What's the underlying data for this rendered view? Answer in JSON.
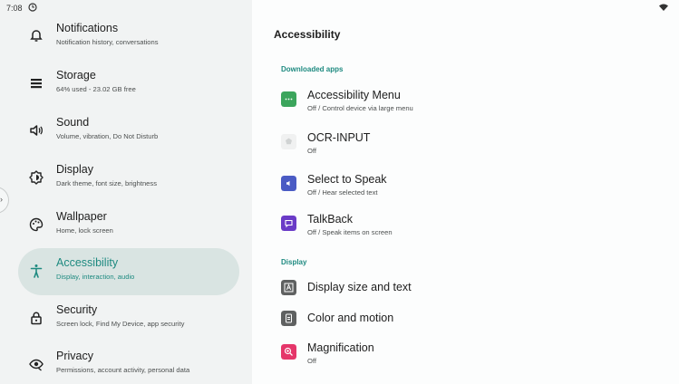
{
  "status_bar": {
    "time": "7:08",
    "clock_icon": "clock-icon",
    "wifi_icon": "wifi-icon"
  },
  "sidebar": {
    "items": [
      {
        "title": "Notifications",
        "subtitle": "Notification history, conversations",
        "icon": "bell-icon"
      },
      {
        "title": "Storage",
        "subtitle": "64% used - 23.02 GB free",
        "icon": "storage-icon"
      },
      {
        "title": "Sound",
        "subtitle": "Volume, vibration, Do Not Disturb",
        "icon": "speaker-icon"
      },
      {
        "title": "Display",
        "subtitle": "Dark theme, font size, brightness",
        "icon": "brightness-icon"
      },
      {
        "title": "Wallpaper",
        "subtitle": "Home, lock screen",
        "icon": "palette-icon"
      },
      {
        "title": "Accessibility",
        "subtitle": "Display, interaction, audio",
        "icon": "accessibility-icon",
        "active": true
      },
      {
        "title": "Security",
        "subtitle": "Screen lock, Find My Device, app security",
        "icon": "lock-icon"
      },
      {
        "title": "Privacy",
        "subtitle": "Permissions, account activity, personal data",
        "icon": "eye-icon"
      }
    ],
    "handle_glyph": "›"
  },
  "detail": {
    "title": "Accessibility",
    "section_downloaded": "Downloaded apps",
    "section_display": "Display",
    "prefs": [
      {
        "title": "Accessibility Menu",
        "subtitle": "Off / Control device via large menu",
        "icon": "accessibility-menu-icon",
        "color": "#3ba55c"
      },
      {
        "title": "OCR-INPUT",
        "subtitle": "Off",
        "icon": "ocr-input-icon",
        "color": "#f0f1f1"
      },
      {
        "title": "Select to Speak",
        "subtitle": "Off / Hear selected text",
        "icon": "select-to-speak-icon",
        "color": "#4a5bc4"
      },
      {
        "title": "TalkBack",
        "subtitle": "Off / Speak items on screen",
        "icon": "talkback-icon",
        "color": "#6a3bc7"
      },
      {
        "title": "Display size and text",
        "subtitle": "",
        "icon": "display-size-icon",
        "color": "#5f6161"
      },
      {
        "title": "Color and motion",
        "subtitle": "",
        "icon": "color-motion-icon",
        "color": "#5f6161"
      },
      {
        "title": "Magnification",
        "subtitle": "Off",
        "icon": "magnification-icon",
        "color": "#e5366a"
      }
    ]
  },
  "colors": {
    "accent": "#1e8a80",
    "active_bg": "#d9e4e2"
  }
}
